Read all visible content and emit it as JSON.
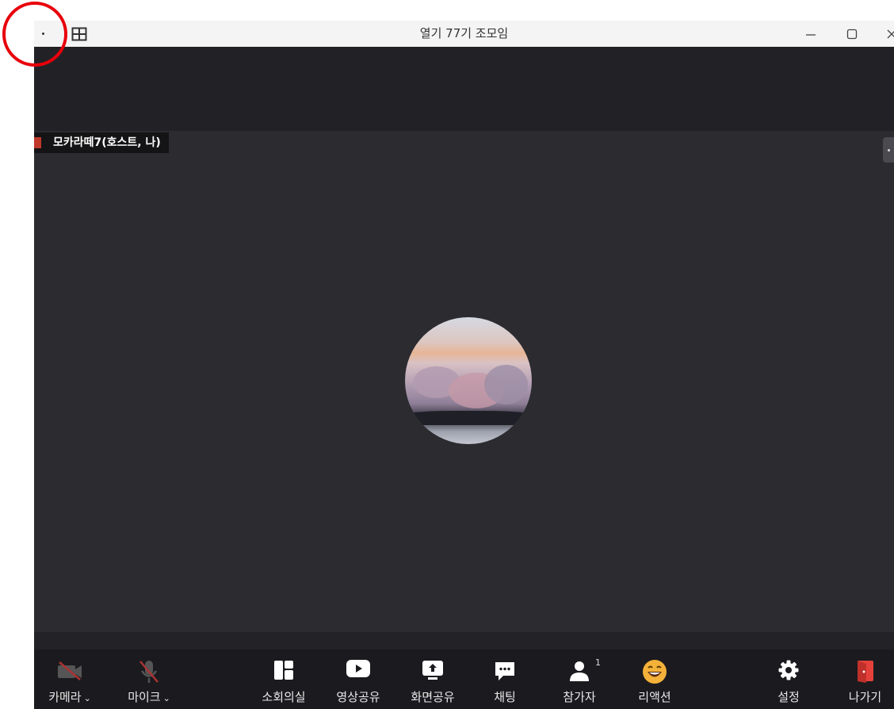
{
  "window": {
    "title": "열기 77기 조모임",
    "controls": [
      "minimize",
      "maximize",
      "close"
    ]
  },
  "participant": {
    "name_tag": "모카라떼7(호스트, 나)"
  },
  "toolbar": {
    "camera_label": "카메라",
    "mic_label": "마이크",
    "breakout_label": "소회의실",
    "video_share_label": "영상공유",
    "screen_share_label": "화면공유",
    "chat_label": "채팅",
    "participants_label": "참가자",
    "participants_count": "1",
    "reaction_label": "리액션",
    "settings_label": "설정",
    "leave_label": "나가기"
  },
  "colors": {
    "background": "#2b2b30",
    "toolbar": "#1b1b1f",
    "leave_red": "#e5413b",
    "reaction_yellow": "#f4b23a",
    "annotation_circle": "#e8000b"
  },
  "annotation": {
    "type": "circle",
    "target": "more-options-icon"
  }
}
